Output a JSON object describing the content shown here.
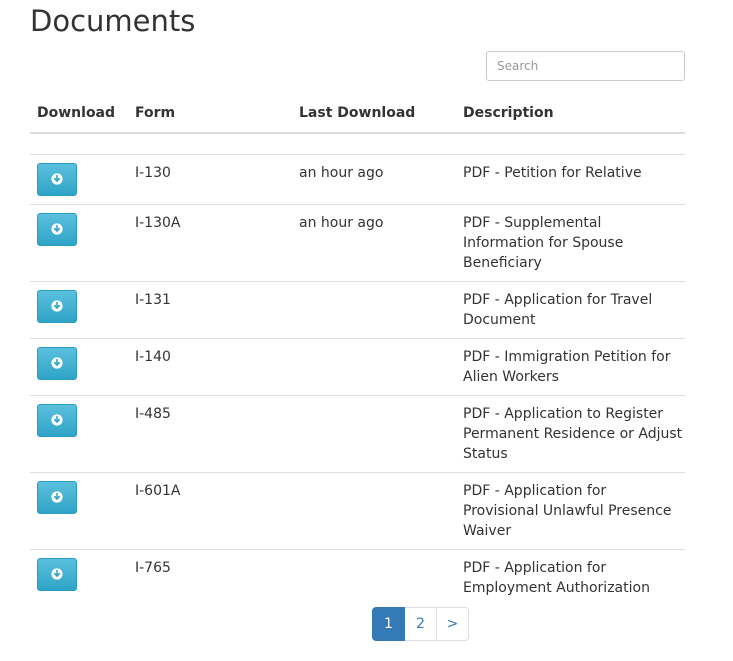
{
  "page": {
    "title": "Documents"
  },
  "search": {
    "placeholder": "Search",
    "value": ""
  },
  "table": {
    "headers": {
      "download": "Download",
      "form": "Form",
      "last_download": "Last Download",
      "description": "Description"
    },
    "rows": [
      {
        "form": "I-130",
        "last_download": "an hour ago",
        "description": "PDF - Petition for Relative"
      },
      {
        "form": "I-130A",
        "last_download": "an hour ago",
        "description": "PDF - Supplemental Information for Spouse Beneficiary"
      },
      {
        "form": "I-131",
        "last_download": "",
        "description": "PDF - Application for Travel Document"
      },
      {
        "form": "I-140",
        "last_download": "",
        "description": "PDF - Immigration Petition for Alien Workers"
      },
      {
        "form": "I-485",
        "last_download": "",
        "description": "PDF - Application to Register Permanent Residence or Adjust Status"
      },
      {
        "form": "I-601A",
        "last_download": "",
        "description": "PDF - Application for Provisional Unlawful Presence Waiver"
      },
      {
        "form": "I-765",
        "last_download": "",
        "description": "PDF - Application for Employment Authorization"
      }
    ]
  },
  "download_icon": "download-circle-icon",
  "pagination": {
    "pages": [
      "1",
      "2"
    ],
    "active": "1",
    "next_label": ">"
  },
  "colors": {
    "download_button": "#5bc0de",
    "active_page": "#337ab7",
    "link": "#337ab7"
  }
}
